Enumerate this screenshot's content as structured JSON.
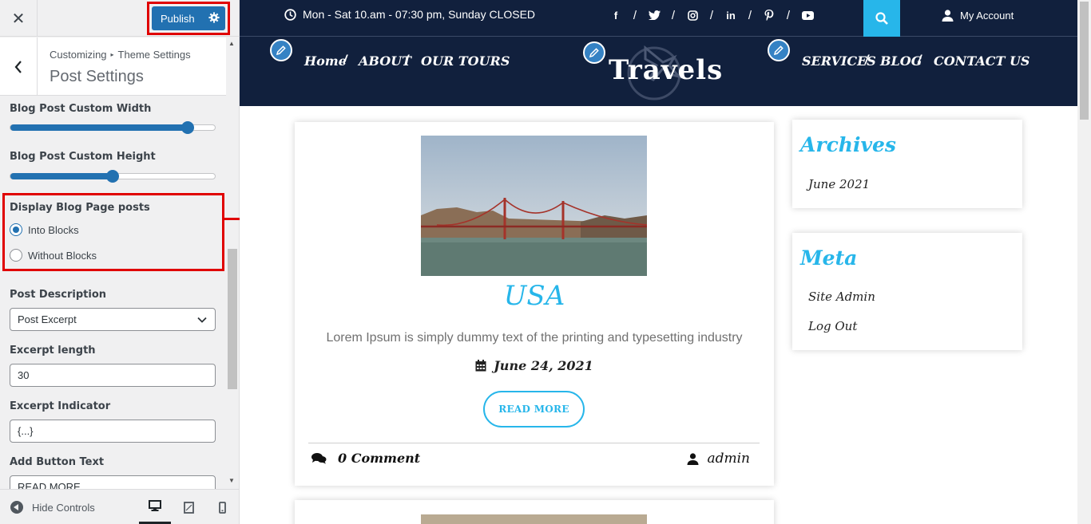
{
  "customizer": {
    "close_glyph": "✕",
    "publish_label": "Publish",
    "breadcrumb_root": "Customizing",
    "breadcrumb_section": "Theme Settings",
    "panel_title": "Post Settings",
    "controls": {
      "width_label": "Blog Post Custom Width",
      "width_value_fraction": 0.89,
      "height_label": "Blog Post Custom Height",
      "height_value_fraction": 0.5,
      "display_label": "Display Blog Page posts",
      "display_options": [
        "Into Blocks",
        "Without Blocks"
      ],
      "display_selected": "Into Blocks",
      "description_label": "Post Description",
      "description_value": "Post Excerpt",
      "excerpt_length_label": "Excerpt length",
      "excerpt_length_value": "30",
      "excerpt_indicator_label": "Excerpt Indicator",
      "excerpt_indicator_value": "{...}",
      "button_text_label": "Add Button Text",
      "button_text_value": "READ MORE"
    },
    "footer": {
      "hide_controls": "Hide Controls",
      "devices": [
        "desktop",
        "tablet",
        "mobile"
      ],
      "active_device": "desktop"
    }
  },
  "site": {
    "hours": "Mon - Sat 10.am - 07:30 pm, Sunday CLOSED",
    "social_icons": [
      "facebook-icon",
      "twitter-icon",
      "instagram-icon",
      "linkedin-icon",
      "pinterest-icon",
      "youtube-icon"
    ],
    "account_label": "My Account",
    "logo_text": "Travels",
    "nav_left": [
      "Home",
      "ABOUT",
      "OUR TOURS"
    ],
    "nav_right": [
      "SERVICES",
      "BLOG",
      "CONTACT US"
    ],
    "post": {
      "title": "USA",
      "excerpt": "Lorem Ipsum is simply dummy text of the printing and typesetting industry",
      "date": "June 24, 2021",
      "read_more": "READ MORE",
      "comments": "0 Comment",
      "author": "admin"
    },
    "archives": {
      "title": "Archives",
      "items": [
        "June 2021"
      ]
    },
    "meta": {
      "title": "Meta",
      "items": [
        "Site Admin",
        "Log Out"
      ]
    },
    "colors": {
      "header_bg": "#11203d",
      "accent": "#27b6ea",
      "wp_blue": "#2271b1",
      "highlight_red": "#e00000"
    }
  }
}
